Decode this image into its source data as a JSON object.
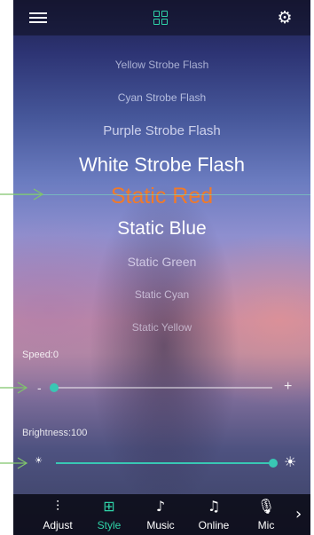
{
  "header": {
    "menu_icon": "list-menu-icon",
    "center_icon": "grid-icon",
    "settings_icon": "gear-icon"
  },
  "styles": [
    {
      "label": "Yellow Strobe Flash"
    },
    {
      "label": "Cyan Strobe Flash"
    },
    {
      "label": "Purple Strobe Flash"
    },
    {
      "label": "White Strobe Flash"
    },
    {
      "label": "Static Red",
      "selected": true
    },
    {
      "label": "Static Blue"
    },
    {
      "label": "Static Green"
    },
    {
      "label": "Static Cyan"
    },
    {
      "label": "Static Yellow"
    }
  ],
  "speed": {
    "label": "Speed:0",
    "value": 0,
    "min_label": "-",
    "max_label": "+"
  },
  "brightness": {
    "label": "Brightness:100",
    "value": 100,
    "min_icon": "sun-small-icon",
    "max_icon": "sun-large-icon"
  },
  "nav": {
    "items": [
      {
        "label": "Adjust",
        "icon": "sliders-icon"
      },
      {
        "label": "Style",
        "icon": "grid-icon",
        "active": true
      },
      {
        "label": "Music",
        "icon": "music-icon"
      },
      {
        "label": "Online",
        "icon": "online-music-icon"
      },
      {
        "label": "Mic",
        "icon": "microphone-icon"
      }
    ],
    "more_icon": "chevron-right-icon"
  },
  "colors": {
    "accent": "#39c7b4",
    "selected_text": "#f07a2a",
    "active_nav": "#2fd3a8"
  }
}
